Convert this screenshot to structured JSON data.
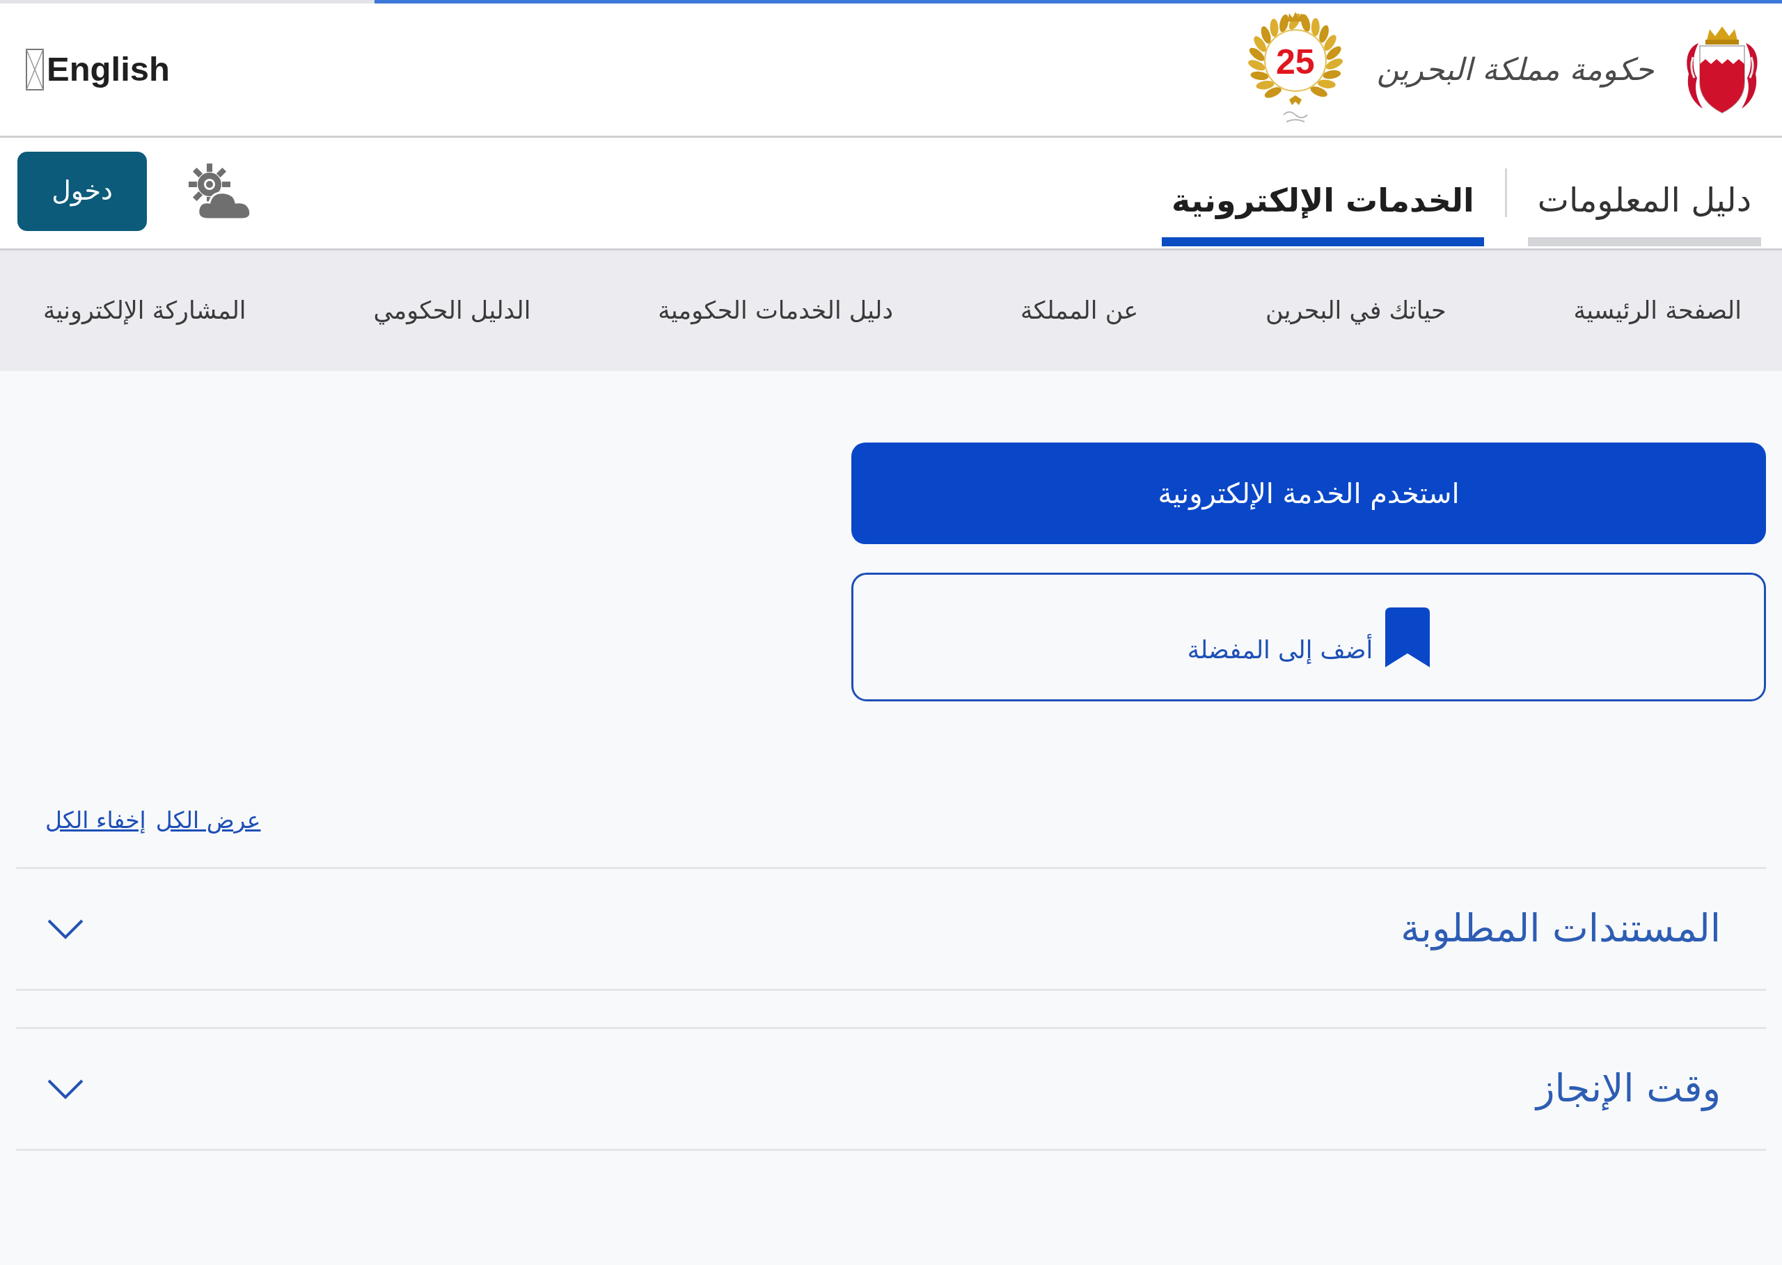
{
  "loading_bar": {
    "level": 0.79
  },
  "header": {
    "language_link": "English",
    "logo_text": "حكومة مملكة البحرين",
    "badge_number": "25"
  },
  "top_bar": {
    "tabs": [
      {
        "label": "دليل المعلومات",
        "selected": false
      },
      {
        "label": "الخدمات الإلكترونية",
        "selected": true
      }
    ],
    "login_button": "دخول"
  },
  "nav": {
    "items": [
      "الصفحة الرئيسية",
      "حياتك في البحرين",
      "عن المملكة",
      "دليل الخدمات الحكومية",
      "الدليل الحكومي",
      "المشاركة الإلكترونية"
    ]
  },
  "actions": {
    "primary_button": "استخدم الخدمة الإلكترونية",
    "favorite_button": "أضف إلى المفضلة"
  },
  "toggle_links": [
    "عرض الكل",
    "إخفاء الكل"
  ],
  "accordion": [
    {
      "title": "المستندات المطلوبة",
      "expanded": false
    },
    {
      "title": "وقت الإنجاز",
      "expanded": false
    }
  ]
}
